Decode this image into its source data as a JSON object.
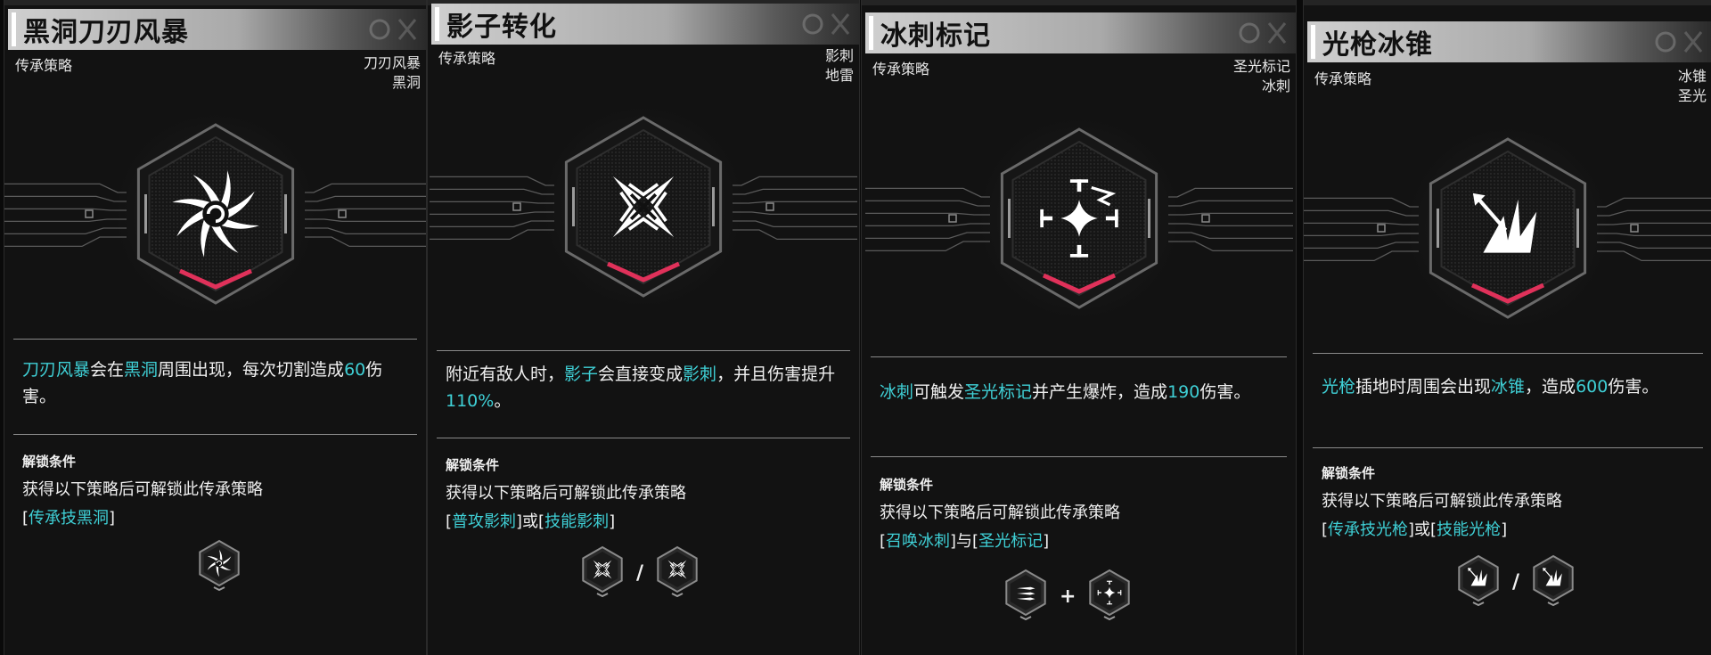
{
  "cards": [
    {
      "title": "黑洞刀刃风暴",
      "category": "传承策略",
      "tags": [
        "刀刃风暴",
        "黑洞"
      ],
      "desc_parts": [
        {
          "t": "刀刃风暴",
          "hl": true
        },
        {
          "t": "会在",
          "hl": false
        },
        {
          "t": "黑洞",
          "hl": true
        },
        {
          "t": "周围出现，每次切割造成",
          "hl": false
        },
        {
          "t": "60",
          "hl": true
        },
        {
          "t": "伤害。",
          "hl": false
        }
      ],
      "unlock_title": "解锁条件",
      "unlock_text": "获得以下策略后可解锁此传承策略",
      "req_parts": [
        {
          "t": "[",
          "hl": false
        },
        {
          "t": "传承技黑洞",
          "hl": true
        },
        {
          "t": "]",
          "hl": false
        }
      ],
      "req_icons": [
        "blackhole-icon"
      ],
      "req_separators": [],
      "emblem_icon": "blade-storm-icon"
    },
    {
      "title": "影子转化",
      "category": "传承策略",
      "tags": [
        "影刺",
        "地雷"
      ],
      "desc_parts": [
        {
          "t": "附近有敌人时，",
          "hl": false
        },
        {
          "t": "影子",
          "hl": true
        },
        {
          "t": "会直接变成",
          "hl": false
        },
        {
          "t": "影刺",
          "hl": true
        },
        {
          "t": "，并且伤害提升",
          "hl": false
        },
        {
          "t": "110%",
          "hl": true
        },
        {
          "t": "。",
          "hl": false
        }
      ],
      "unlock_title": "解锁条件",
      "unlock_text": "获得以下策略后可解锁此传承策略",
      "req_parts": [
        {
          "t": "[",
          "hl": false
        },
        {
          "t": "普攻影刺",
          "hl": true
        },
        {
          "t": "]或[",
          "hl": false
        },
        {
          "t": "技能影刺",
          "hl": true
        },
        {
          "t": "]",
          "hl": false
        }
      ],
      "req_icons": [
        "shadow-spike-icon",
        "shadow-spike-icon"
      ],
      "req_separators": [
        "/"
      ],
      "emblem_icon": "shadow-spike-icon"
    },
    {
      "title": "冰刺标记",
      "category": "传承策略",
      "tags": [
        "圣光标记",
        "冰刺"
      ],
      "desc_parts": [
        {
          "t": "冰刺",
          "hl": true
        },
        {
          "t": "可触发",
          "hl": false
        },
        {
          "t": "圣光标记",
          "hl": true
        },
        {
          "t": "并产生爆炸，造成",
          "hl": false
        },
        {
          "t": "190",
          "hl": true
        },
        {
          "t": "伤害。",
          "hl": false
        }
      ],
      "unlock_title": "解锁条件",
      "unlock_text": "获得以下策略后可解锁此传承策略",
      "req_parts": [
        {
          "t": "[",
          "hl": false
        },
        {
          "t": "召唤冰刺",
          "hl": true
        },
        {
          "t": "]与[",
          "hl": false
        },
        {
          "t": "圣光标记",
          "hl": true
        },
        {
          "t": "]",
          "hl": false
        }
      ],
      "req_icons": [
        "ice-spike-icon",
        "holy-mark-icon"
      ],
      "req_separators": [
        "+"
      ],
      "emblem_icon": "ice-mark-icon"
    },
    {
      "title": "光枪冰锥",
      "category": "传承策略",
      "tags": [
        "冰锥",
        "圣光"
      ],
      "desc_parts": [
        {
          "t": "光枪",
          "hl": true
        },
        {
          "t": "插地时周围会出现",
          "hl": false
        },
        {
          "t": "冰锥",
          "hl": true
        },
        {
          "t": "，造成",
          "hl": false
        },
        {
          "t": "600",
          "hl": true
        },
        {
          "t": "伤害。",
          "hl": false
        }
      ],
      "unlock_title": "解锁条件",
      "unlock_text": "获得以下策略后可解锁此传承策略",
      "req_parts": [
        {
          "t": "[",
          "hl": false
        },
        {
          "t": "传承技光枪",
          "hl": true
        },
        {
          "t": "]或[",
          "hl": false
        },
        {
          "t": "技能光枪",
          "hl": true
        },
        {
          "t": "]",
          "hl": false
        }
      ],
      "req_icons": [
        "light-lance-icon",
        "light-lance-icon"
      ],
      "req_separators": [
        "/"
      ],
      "emblem_icon": "ice-cone-icon"
    }
  ]
}
